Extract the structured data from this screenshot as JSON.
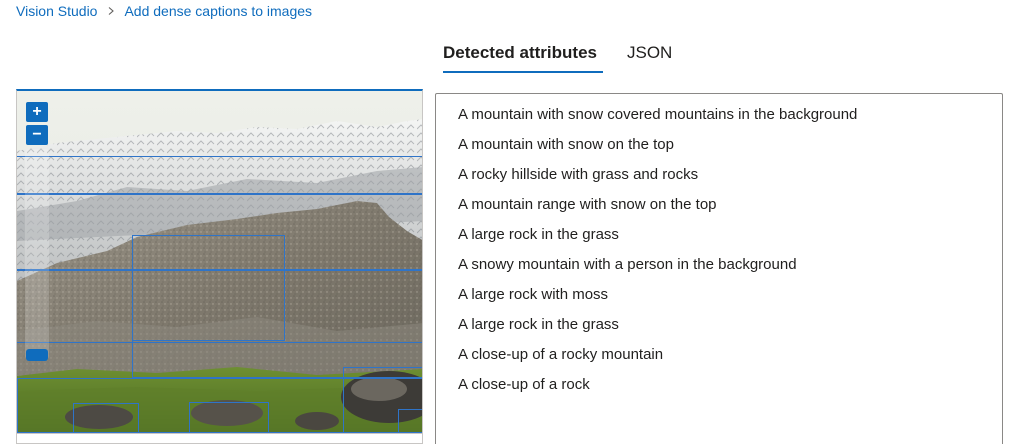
{
  "breadcrumb": {
    "items": [
      "Vision Studio",
      "Add dense captions to images"
    ]
  },
  "tabs": [
    {
      "label": "Detected attributes",
      "active": true
    },
    {
      "label": "JSON",
      "active": false
    }
  ],
  "viewer": {
    "zoom_in_label": "+",
    "zoom_out_label": "−"
  },
  "captions": [
    "A mountain with snow covered mountains in the background",
    "A mountain with snow on the top",
    "A rocky hillside with grass and rocks",
    "A mountain range with snow on the top",
    "A large rock in the grass",
    "A snowy mountain with a person in the background",
    "A large rock with moss",
    "A large rock in the grass",
    "A close-up of a rocky mountain",
    "A close-up of a rock"
  ],
  "colors": {
    "accent": "#0f6cbd",
    "bounding_box": "#2f74c8"
  }
}
